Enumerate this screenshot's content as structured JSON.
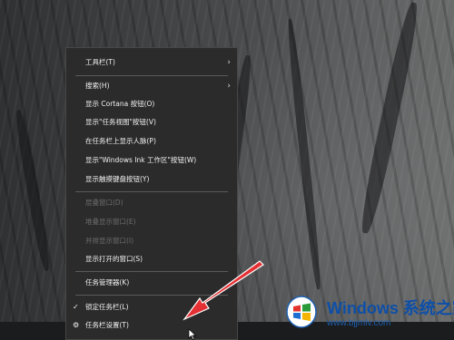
{
  "context_menu": {
    "items": [
      {
        "label": "工具栏(T)",
        "submenu": true,
        "enabled": true
      },
      {
        "label": "搜索(H)",
        "submenu": true,
        "enabled": true
      },
      {
        "label": "显示 Cortana 按钮(O)",
        "enabled": true
      },
      {
        "label": "显示\"任务视图\"按钮(V)",
        "enabled": true
      },
      {
        "label": "在任务栏上显示人脉(P)",
        "enabled": true
      },
      {
        "label": "显示\"Windows Ink 工作区\"按钮(W)",
        "enabled": true
      },
      {
        "label": "显示触摸键盘按钮(Y)",
        "enabled": true
      },
      {
        "label": "层叠窗口(D)",
        "enabled": false
      },
      {
        "label": "堆叠显示窗口(E)",
        "enabled": false
      },
      {
        "label": "并排显示窗口(I)",
        "enabled": false
      },
      {
        "label": "显示打开的窗口(S)",
        "enabled": true
      },
      {
        "label": "任务管理器(K)",
        "enabled": true
      },
      {
        "label": "锁定任务栏(L)",
        "enabled": true,
        "checked": true
      },
      {
        "label": "任务栏设置(T)",
        "enabled": true,
        "icon": "gear-icon"
      }
    ]
  },
  "watermark": {
    "brand": "Windows",
    "brand_cn": "系统之家",
    "url": "www.bjjmlv.com"
  },
  "colors": {
    "menu_bg": "#2b2b2b",
    "arrow_red": "#e0252b",
    "brand_blue": "#0d4fa8"
  }
}
